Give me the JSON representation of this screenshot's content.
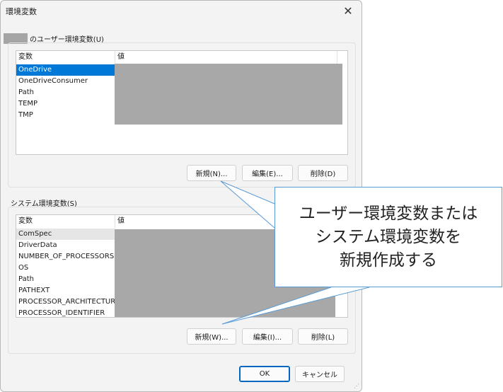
{
  "dialog": {
    "title": "環境変数",
    "close_glyph": "✕",
    "user_section": {
      "label": "のユーザー環境変数(U)",
      "columns": [
        "変数",
        "値"
      ],
      "rows": [
        "OneDrive",
        "OneDriveConsumer",
        "Path",
        "TEMP",
        "TMP"
      ],
      "selected_row": "OneDrive",
      "buttons": {
        "new": "新規(N)...",
        "edit": "編集(E)...",
        "delete": "削除(D)"
      }
    },
    "system_section": {
      "label": "システム環境変数(S)",
      "columns": [
        "変数",
        "値"
      ],
      "rows": [
        "ComSpec",
        "DriverData",
        "NUMBER_OF_PROCESSORS",
        "OS",
        "Path",
        "PATHEXT",
        "PROCESSOR_ARCHITECTURE",
        "PROCESSOR_IDENTIFIER"
      ],
      "selected_row": "ComSpec",
      "buttons": {
        "new": "新規(W)...",
        "edit": "編集(I)...",
        "delete": "削除(L)"
      }
    },
    "footer": {
      "ok": "OK",
      "cancel": "キャンセル"
    }
  },
  "callout": {
    "lines": [
      "ユーザー環境変数または",
      "システム環境変数を",
      "新規作成する"
    ],
    "border_color": "#5b9bd5"
  },
  "colors": {
    "selection": "#0078d7",
    "redaction": "#a8a8a8"
  }
}
